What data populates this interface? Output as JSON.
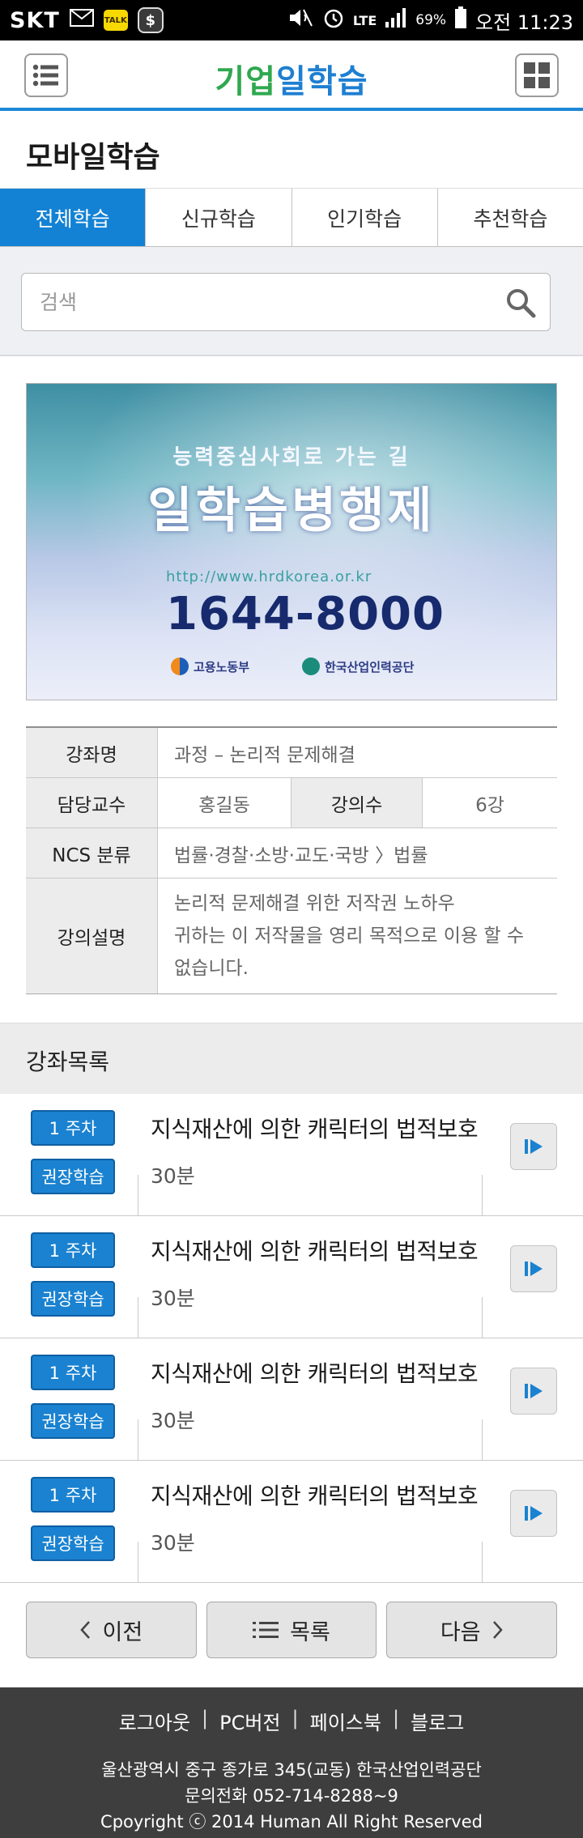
{
  "status_bar": {
    "carrier": "SKT",
    "talk_badge": "TALK",
    "network": "LTE",
    "battery": "69%",
    "time": "오전 11:23"
  },
  "header": {
    "logo_part1": "기업",
    "logo_part2": "일학습",
    "menu_icon": "list-menu-icon",
    "grid_icon": "grid-icon",
    "colors": {
      "accent": "#1e88d6",
      "logo_green": "#2fa84f",
      "logo_blue": "#1e7fd1"
    }
  },
  "page": {
    "title": "모바일학습"
  },
  "tabs": [
    {
      "label": "전체학습",
      "active": true
    },
    {
      "label": "신규학습",
      "active": false
    },
    {
      "label": "인기학습",
      "active": false
    },
    {
      "label": "추천학습",
      "active": false
    }
  ],
  "search": {
    "placeholder": "검색",
    "value": "",
    "icon": "search-icon"
  },
  "banner": {
    "tagline": "능력중심사회로 가는 길",
    "headline": "일학습병행제",
    "url": "http://www.hrdkorea.or.kr",
    "phone": "1644-8000",
    "org1": "고용노동부",
    "org2": "한국산업인력공단"
  },
  "course_info": {
    "name_label": "강좌명",
    "name_value": "과정 – 논리적 문제해결",
    "professor_label": "담당교수",
    "professor_value": "홍길동",
    "lectures_label": "강의수",
    "lectures_value": "6강",
    "ncs_label": "NCS 분류",
    "ncs_value": "법률·경찰·소방·교도·국방 〉법률",
    "desc_label": "강의설명",
    "desc_line1": "논리적 문제해결 위한 저작권 노하우",
    "desc_line2": "귀하는 이 저작물을 영리 목적으로 이용 할 수",
    "desc_line3": "없습니다."
  },
  "lecture_list": {
    "title": "강좌목록",
    "items": [
      {
        "week": "1 주차",
        "tag": "권장학습",
        "title": "지식재산에 의한 캐릭터의 법적보호",
        "duration": "30분"
      },
      {
        "week": "1 주차",
        "tag": "권장학습",
        "title": "지식재산에 의한 캐릭터의 법적보호",
        "duration": "30분"
      },
      {
        "week": "1 주차",
        "tag": "권장학습",
        "title": "지식재산에 의한 캐릭터의 법적보호",
        "duration": "30분"
      },
      {
        "week": "1 주차",
        "tag": "권장학습",
        "title": "지식재산에 의한 캐릭터의 법적보호",
        "duration": "30분"
      }
    ]
  },
  "pager": {
    "prev": "이전",
    "list": "목록",
    "next": "다음"
  },
  "footer": {
    "links": [
      "로그아웃",
      "PC버전",
      "페이스북",
      "블로그"
    ],
    "address": "울산광역시 중구 종가로 345(교동) 한국산업인력공단",
    "phone": "문의전화 052-714-8288~9",
    "copyright": "Cpoyright ⓒ 2014 Human All Right Reserved"
  }
}
